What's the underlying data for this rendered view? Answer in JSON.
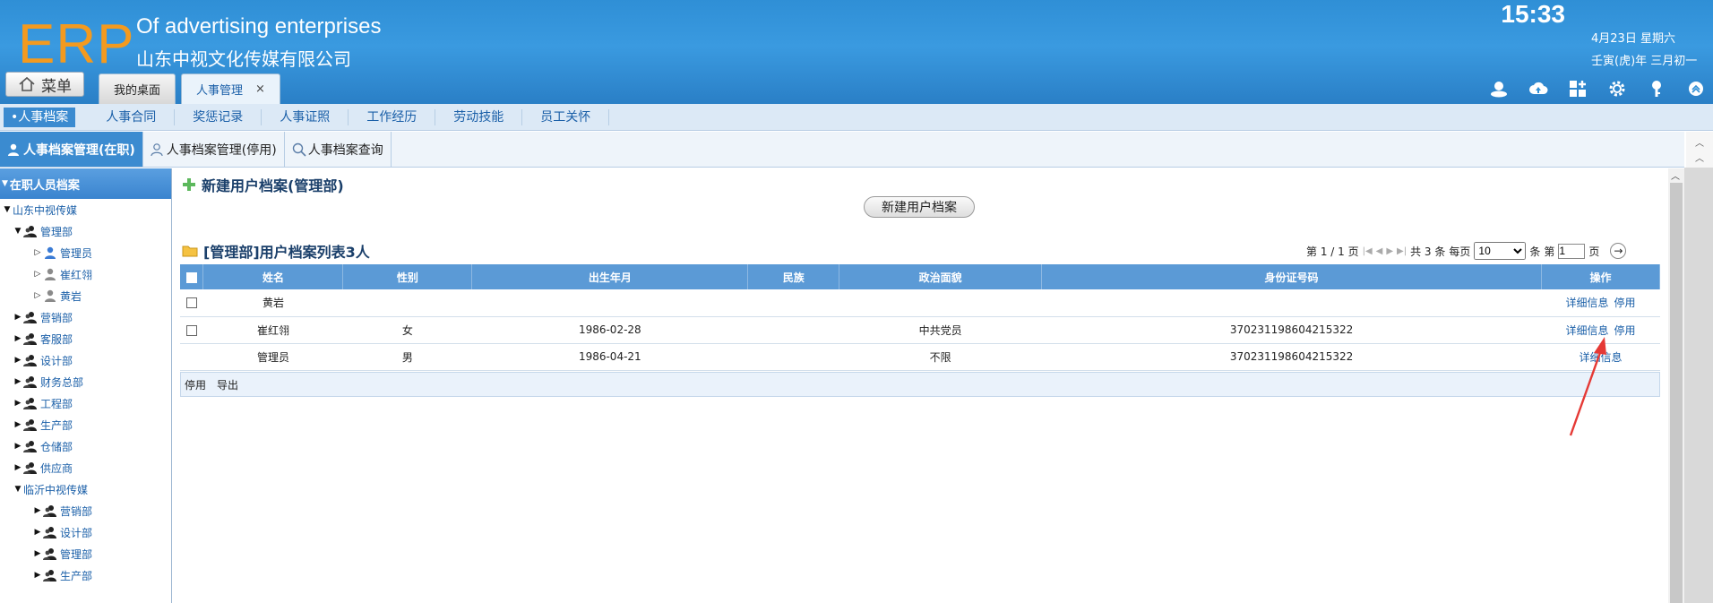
{
  "header": {
    "logo": "ERP",
    "company_en": "Of advertising enterprises",
    "company_cn": "山东中视文化传媒有限公司",
    "time": "15:33",
    "date": "4月23日 星期六",
    "lunar": "壬寅(虎)年 三月初一",
    "menu_label": "菜单",
    "tabs": [
      {
        "label": "我的桌面",
        "active": false
      },
      {
        "label": "人事管理",
        "active": true,
        "closable": true
      }
    ],
    "close_glyph": "×",
    "toolbar_icons": [
      "user-icon",
      "cloud-upload-icon",
      "grid-plus-icon",
      "gear-icon",
      "key-icon",
      "collapse-up-icon"
    ]
  },
  "subnav": {
    "items": [
      "•人事档案",
      "人事合同",
      "奖惩记录",
      "人事证照",
      "工作经历",
      "劳动技能",
      "员工关怀"
    ]
  },
  "tabbar2": {
    "items": [
      "人事档案管理(在职)",
      "人事档案管理(停用)",
      "人事档案查询"
    ]
  },
  "tree": {
    "head": "在职人员档案",
    "nodes": [
      {
        "label": "山东中视传媒",
        "level": 0,
        "expanded": true,
        "icon": "none"
      },
      {
        "label": "管理部",
        "level": 1,
        "expanded": true,
        "icon": "group-icon"
      },
      {
        "label": "管理员",
        "level": 2,
        "icon": "user-blue-icon"
      },
      {
        "label": "崔红翎",
        "level": 2,
        "icon": "user-gray-icon"
      },
      {
        "label": "黄岩",
        "level": 2,
        "icon": "user-gray-icon"
      },
      {
        "label": "营销部",
        "level": 1,
        "icon": "group-icon"
      },
      {
        "label": "客服部",
        "level": 1,
        "icon": "group-icon"
      },
      {
        "label": "设计部",
        "level": 1,
        "icon": "group-icon"
      },
      {
        "label": "财务总部",
        "level": 1,
        "icon": "group-icon"
      },
      {
        "label": "工程部",
        "level": 1,
        "icon": "group-icon"
      },
      {
        "label": "生产部",
        "level": 1,
        "icon": "group-icon"
      },
      {
        "label": "仓储部",
        "level": 1,
        "icon": "group-icon"
      },
      {
        "label": "供应商",
        "level": 1,
        "icon": "group-icon"
      },
      {
        "label": "临沂中视传媒",
        "level": 1,
        "expanded": true,
        "icon": "none"
      },
      {
        "label": "营销部",
        "level": 2,
        "icon": "group-icon"
      },
      {
        "label": "设计部",
        "level": 2,
        "icon": "group-icon"
      },
      {
        "label": "管理部",
        "level": 2,
        "icon": "group-icon"
      },
      {
        "label": "生产部",
        "level": 2,
        "icon": "group-icon"
      }
    ]
  },
  "content": {
    "new_section_title": "新建用户档案(管理部)",
    "new_button": "新建用户档案",
    "list_title": "[管理部]用户档案列表3人",
    "pager": {
      "page_info": "第 1 / 1 页",
      "total": "共 3 条",
      "per_page_label": "每页",
      "per_page_value": "10",
      "per_page_unit": "条",
      "goto_label": "第",
      "goto_value": "1",
      "goto_unit": "页",
      "go_glyph": "→"
    },
    "columns": [
      "姓名",
      "性别",
      "出生年月",
      "民族",
      "政治面貌",
      "身份证号码",
      "操作"
    ],
    "rows": [
      {
        "name": "黄岩",
        "gender": "",
        "birth": "",
        "ethnic": "",
        "political": "",
        "id_no": "",
        "has_checkbox": true,
        "actions": [
          "详细信息",
          "停用"
        ]
      },
      {
        "name": "崔红翎",
        "gender": "女",
        "birth": "1986-02-28",
        "ethnic": "",
        "political": "中共党员",
        "id_no": "370231198604215322",
        "has_checkbox": true,
        "actions": [
          "详细信息",
          "停用"
        ]
      },
      {
        "name": "管理员",
        "gender": "男",
        "birth": "1986-04-21",
        "ethnic": "",
        "political": "不限",
        "id_no": "370231198604215322",
        "has_checkbox": false,
        "actions": [
          "详细信息"
        ]
      }
    ],
    "footer_actions": [
      "停用",
      "导出"
    ]
  },
  "colors": {
    "header": "#2f8fd6",
    "logo": "#f39a1f",
    "table_head": "#5b9ad6",
    "annotation_arrow": "#e53935"
  }
}
